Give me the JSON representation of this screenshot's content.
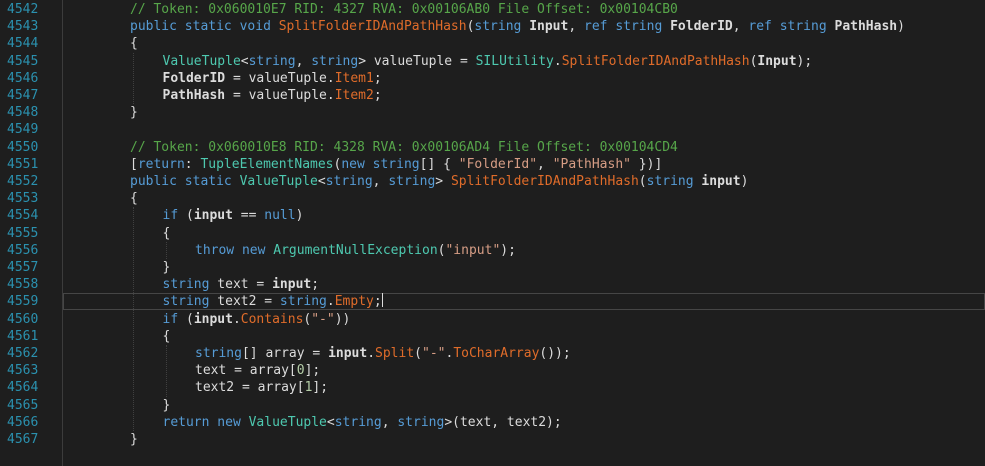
{
  "editor": {
    "colors": {
      "background": "#1e1e1e",
      "line_number": "#2b91af",
      "keyword": "#569cd6",
      "type": "#4ec9b0",
      "method": "#e06c2a",
      "string": "#d69d85",
      "comment": "#57a64a",
      "plain": "#dcdcdc"
    },
    "lines": [
      {
        "n": "4542",
        "indent": 0,
        "t": [
          {
            "k": "cm",
            "v": "// Token: 0x060010E7 RID: 4327 RVA: 0x00106AB0 File Offset: 0x00104CB0"
          }
        ]
      },
      {
        "n": "4543",
        "indent": 0,
        "t": [
          {
            "k": "kw",
            "v": "public"
          },
          {
            "k": "pl",
            "v": " "
          },
          {
            "k": "kw",
            "v": "static"
          },
          {
            "k": "pl",
            "v": " "
          },
          {
            "k": "kw",
            "v": "void"
          },
          {
            "k": "pl",
            "v": " "
          },
          {
            "k": "mt",
            "v": "SplitFolderIDAndPathHash"
          },
          {
            "k": "pl",
            "v": "("
          },
          {
            "k": "kw",
            "v": "string"
          },
          {
            "k": "pl",
            "v": " "
          },
          {
            "k": "pm",
            "v": "Input"
          },
          {
            "k": "pl",
            "v": ", "
          },
          {
            "k": "kw",
            "v": "ref"
          },
          {
            "k": "pl",
            "v": " "
          },
          {
            "k": "kw",
            "v": "string"
          },
          {
            "k": "pl",
            "v": " "
          },
          {
            "k": "pm",
            "v": "FolderID"
          },
          {
            "k": "pl",
            "v": ", "
          },
          {
            "k": "kw",
            "v": "ref"
          },
          {
            "k": "pl",
            "v": " "
          },
          {
            "k": "kw",
            "v": "string"
          },
          {
            "k": "pl",
            "v": " "
          },
          {
            "k": "pm",
            "v": "PathHash"
          },
          {
            "k": "pl",
            "v": ")"
          }
        ]
      },
      {
        "n": "4544",
        "indent": 0,
        "t": [
          {
            "k": "pl",
            "v": "{"
          }
        ]
      },
      {
        "n": "4545",
        "indent": 1,
        "t": [
          {
            "k": "ty",
            "v": "ValueTuple"
          },
          {
            "k": "pl",
            "v": "<"
          },
          {
            "k": "kw",
            "v": "string"
          },
          {
            "k": "pl",
            "v": ", "
          },
          {
            "k": "kw",
            "v": "string"
          },
          {
            "k": "pl",
            "v": "> valueTuple = "
          },
          {
            "k": "ty",
            "v": "SILUtility"
          },
          {
            "k": "pl",
            "v": "."
          },
          {
            "k": "mt",
            "v": "SplitFolderIDAndPathHash"
          },
          {
            "k": "pl",
            "v": "("
          },
          {
            "k": "pm",
            "v": "Input"
          },
          {
            "k": "pl",
            "v": ");"
          }
        ]
      },
      {
        "n": "4546",
        "indent": 1,
        "t": [
          {
            "k": "pm",
            "v": "FolderID"
          },
          {
            "k": "pl",
            "v": " = valueTuple."
          },
          {
            "k": "mt",
            "v": "Item1"
          },
          {
            "k": "pl",
            "v": ";"
          }
        ]
      },
      {
        "n": "4547",
        "indent": 1,
        "t": [
          {
            "k": "pm",
            "v": "PathHash"
          },
          {
            "k": "pl",
            "v": " = valueTuple."
          },
          {
            "k": "mt",
            "v": "Item2"
          },
          {
            "k": "pl",
            "v": ";"
          }
        ]
      },
      {
        "n": "4548",
        "indent": 0,
        "t": [
          {
            "k": "pl",
            "v": "}"
          }
        ]
      },
      {
        "n": "4549",
        "indent": 0,
        "t": []
      },
      {
        "n": "4550",
        "indent": 0,
        "t": [
          {
            "k": "cm",
            "v": "// Token: 0x060010E8 RID: 4328 RVA: 0x00106AD4 File Offset: 0x00104CD4"
          }
        ]
      },
      {
        "n": "4551",
        "indent": 0,
        "t": [
          {
            "k": "pl",
            "v": "["
          },
          {
            "k": "kw",
            "v": "return"
          },
          {
            "k": "pl",
            "v": ": "
          },
          {
            "k": "ty",
            "v": "TupleElementNames"
          },
          {
            "k": "pl",
            "v": "("
          },
          {
            "k": "kw",
            "v": "new"
          },
          {
            "k": "pl",
            "v": " "
          },
          {
            "k": "kw",
            "v": "string"
          },
          {
            "k": "pl",
            "v": "[] { "
          },
          {
            "k": "st",
            "v": "\"FolderId\""
          },
          {
            "k": "pl",
            "v": ", "
          },
          {
            "k": "st",
            "v": "\"PathHash\""
          },
          {
            "k": "pl",
            "v": " })]"
          }
        ]
      },
      {
        "n": "4552",
        "indent": 0,
        "t": [
          {
            "k": "kw",
            "v": "public"
          },
          {
            "k": "pl",
            "v": " "
          },
          {
            "k": "kw",
            "v": "static"
          },
          {
            "k": "pl",
            "v": " "
          },
          {
            "k": "ty",
            "v": "ValueTuple"
          },
          {
            "k": "pl",
            "v": "<"
          },
          {
            "k": "kw",
            "v": "string"
          },
          {
            "k": "pl",
            "v": ", "
          },
          {
            "k": "kw",
            "v": "string"
          },
          {
            "k": "pl",
            "v": "> "
          },
          {
            "k": "mt",
            "v": "SplitFolderIDAndPathHash"
          },
          {
            "k": "pl",
            "v": "("
          },
          {
            "k": "kw",
            "v": "string"
          },
          {
            "k": "pl",
            "v": " "
          },
          {
            "k": "pm",
            "v": "input"
          },
          {
            "k": "pl",
            "v": ")"
          }
        ]
      },
      {
        "n": "4553",
        "indent": 0,
        "t": [
          {
            "k": "pl",
            "v": "{"
          }
        ]
      },
      {
        "n": "4554",
        "indent": 1,
        "t": [
          {
            "k": "kw",
            "v": "if"
          },
          {
            "k": "pl",
            "v": " ("
          },
          {
            "k": "pm",
            "v": "input"
          },
          {
            "k": "pl",
            "v": " == "
          },
          {
            "k": "kw",
            "v": "null"
          },
          {
            "k": "pl",
            "v": ")"
          }
        ]
      },
      {
        "n": "4555",
        "indent": 1,
        "t": [
          {
            "k": "pl",
            "v": "{"
          }
        ]
      },
      {
        "n": "4556",
        "indent": 2,
        "t": [
          {
            "k": "kw",
            "v": "throw"
          },
          {
            "k": "pl",
            "v": " "
          },
          {
            "k": "kw",
            "v": "new"
          },
          {
            "k": "pl",
            "v": " "
          },
          {
            "k": "ty",
            "v": "ArgumentNullException"
          },
          {
            "k": "pl",
            "v": "("
          },
          {
            "k": "st",
            "v": "\"input\""
          },
          {
            "k": "pl",
            "v": ");"
          }
        ]
      },
      {
        "n": "4557",
        "indent": 1,
        "t": [
          {
            "k": "pl",
            "v": "}"
          }
        ]
      },
      {
        "n": "4558",
        "indent": 1,
        "t": [
          {
            "k": "kw",
            "v": "string"
          },
          {
            "k": "pl",
            "v": " text = "
          },
          {
            "k": "pm",
            "v": "input"
          },
          {
            "k": "pl",
            "v": ";"
          }
        ]
      },
      {
        "n": "4559",
        "indent": 1,
        "current": true,
        "t": [
          {
            "k": "kw",
            "v": "string"
          },
          {
            "k": "pl",
            "v": " text2 = "
          },
          {
            "k": "kw",
            "v": "string"
          },
          {
            "k": "pl",
            "v": "."
          },
          {
            "k": "mt",
            "v": "Empty"
          },
          {
            "k": "pl",
            "v": ";"
          }
        ]
      },
      {
        "n": "4560",
        "indent": 1,
        "t": [
          {
            "k": "kw",
            "v": "if"
          },
          {
            "k": "pl",
            "v": " ("
          },
          {
            "k": "pm",
            "v": "input"
          },
          {
            "k": "pl",
            "v": "."
          },
          {
            "k": "mt",
            "v": "Contains"
          },
          {
            "k": "pl",
            "v": "("
          },
          {
            "k": "st",
            "v": "\"-\""
          },
          {
            "k": "pl",
            "v": "))"
          }
        ]
      },
      {
        "n": "4561",
        "indent": 1,
        "t": [
          {
            "k": "pl",
            "v": "{"
          }
        ]
      },
      {
        "n": "4562",
        "indent": 2,
        "t": [
          {
            "k": "kw",
            "v": "string"
          },
          {
            "k": "pl",
            "v": "[] array = "
          },
          {
            "k": "pm",
            "v": "input"
          },
          {
            "k": "pl",
            "v": "."
          },
          {
            "k": "mt",
            "v": "Split"
          },
          {
            "k": "pl",
            "v": "("
          },
          {
            "k": "st",
            "v": "\"-\""
          },
          {
            "k": "pl",
            "v": "."
          },
          {
            "k": "mt",
            "v": "ToCharArray"
          },
          {
            "k": "pl",
            "v": "());"
          }
        ]
      },
      {
        "n": "4563",
        "indent": 2,
        "t": [
          {
            "k": "pl",
            "v": "text = array["
          },
          {
            "k": "nm",
            "v": "0"
          },
          {
            "k": "pl",
            "v": "];"
          }
        ]
      },
      {
        "n": "4564",
        "indent": 2,
        "t": [
          {
            "k": "pl",
            "v": "text2 = array["
          },
          {
            "k": "nm",
            "v": "1"
          },
          {
            "k": "pl",
            "v": "];"
          }
        ]
      },
      {
        "n": "4565",
        "indent": 1,
        "t": [
          {
            "k": "pl",
            "v": "}"
          }
        ]
      },
      {
        "n": "4566",
        "indent": 1,
        "t": [
          {
            "k": "kw",
            "v": "return"
          },
          {
            "k": "pl",
            "v": " "
          },
          {
            "k": "kw",
            "v": "new"
          },
          {
            "k": "pl",
            "v": " "
          },
          {
            "k": "ty",
            "v": "ValueTuple"
          },
          {
            "k": "pl",
            "v": "<"
          },
          {
            "k": "kw",
            "v": "string"
          },
          {
            "k": "pl",
            "v": ", "
          },
          {
            "k": "kw",
            "v": "string"
          },
          {
            "k": "pl",
            "v": ">(text, text2);"
          }
        ]
      },
      {
        "n": "4567",
        "indent": 0,
        "t": [
          {
            "k": "pl",
            "v": "}"
          }
        ]
      }
    ]
  }
}
